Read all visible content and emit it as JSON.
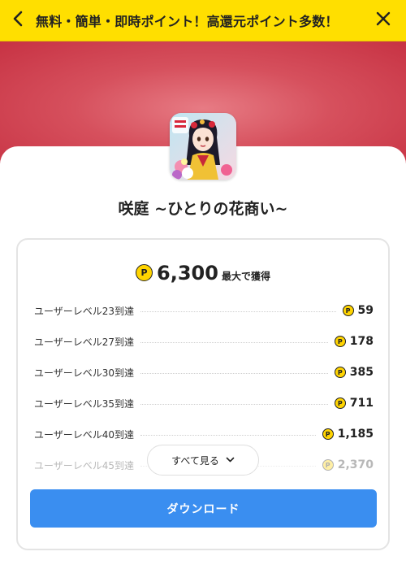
{
  "header": {
    "title": "無料・簡単・即時ポイント！高還元ポイント多数！",
    "back_icon": "chevron-left-icon",
    "close_icon": "close-icon",
    "bg_color": "#ffdf00"
  },
  "app": {
    "name": "咲庭 ~ひとりの花商い~",
    "icon": "app-icon-woman-with-flowers"
  },
  "reward": {
    "coin_symbol": "P",
    "total": "6,300",
    "total_note": "最大で獲得",
    "coin_color": "#ffd400",
    "items": [
      {
        "label": "ユーザーレベル23到達",
        "points": "59"
      },
      {
        "label": "ユーザーレベル27到達",
        "points": "178"
      },
      {
        "label": "ユーザーレベル30到達",
        "points": "385"
      },
      {
        "label": "ユーザーレベル35到達",
        "points": "711"
      },
      {
        "label": "ユーザーレベル40到達",
        "points": "1,185"
      },
      {
        "label": "ユーザーレベル45到達",
        "points": "2,370"
      }
    ]
  },
  "actions": {
    "see_all_label": "すべて見る",
    "download_label": "ダウンロード",
    "download_color": "#3a8ef0"
  }
}
